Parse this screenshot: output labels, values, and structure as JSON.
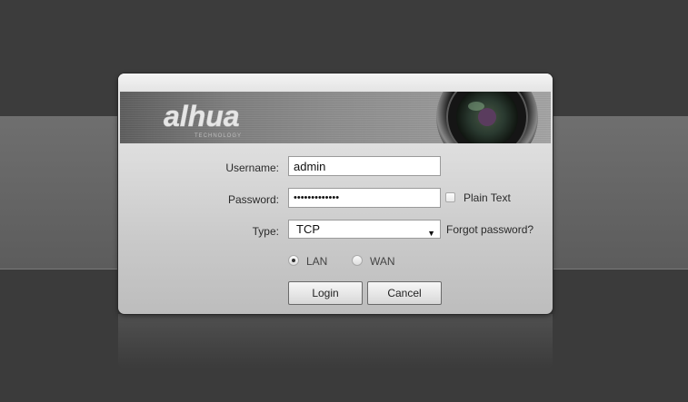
{
  "brand": {
    "name": "alhua",
    "tagline": "TECHNOLOGY"
  },
  "form": {
    "username_label": "Username:",
    "username_value": "admin",
    "password_label": "Password:",
    "password_value": "•••••••••••••",
    "plain_text_label": "Plain Text",
    "type_label": "Type:",
    "type_value": "TCP",
    "forgot_password": "Forgot password?",
    "network": {
      "lan_label": "LAN",
      "wan_label": "WAN",
      "selected": "LAN"
    }
  },
  "buttons": {
    "login": "Login",
    "cancel": "Cancel"
  },
  "icons": {
    "dropdown": "chevron-down-icon",
    "lens": "camera-lens-icon"
  },
  "colors": {
    "background": "#3a3a3a",
    "dialog": "#d6d6d6",
    "banner": "#7e7e7e"
  }
}
